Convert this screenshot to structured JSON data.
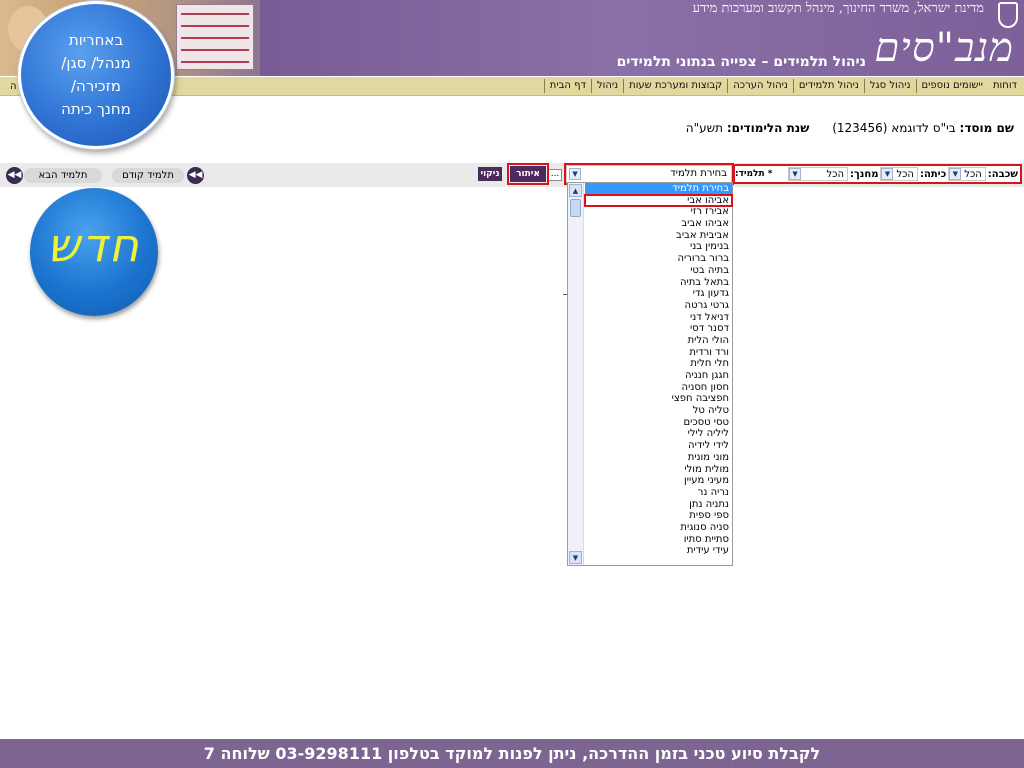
{
  "header": {
    "ministry_text": "מדינת ישראל, משרד החינוך, מינהל תקשוב ומערכות מידע",
    "logo_text": "מנב\"סים",
    "subtitle": "ניהול תלמידים – צפייה בנתוני תלמידים"
  },
  "nav": {
    "items": [
      "דף הבית",
      "ניהול",
      "קבוצות ומערכת שעות",
      "ניהול הערכה",
      "ניהול תלמידים",
      "ניהול סגל",
      "יישומים נוספים",
      "דוחות"
    ],
    "stub": "ה"
  },
  "institute": {
    "name_label": "שם מוסד:",
    "name_value": "בי\"ס לדוגמא (123456)",
    "year_label": "שנת הלימודים:",
    "year_value": "תשע\"ה"
  },
  "filters": {
    "grade_label": "שכבה:",
    "grade_value": "הכל",
    "class_label": "כיתה:",
    "class_value": "הכל",
    "teacher_label": "מחנך:",
    "teacher_value": "הכל",
    "student_label": "* תלמיד:",
    "student_value": "בחירת תלמיד",
    "dots": "...",
    "filter_button": "איתור",
    "clear_button": "ניקוי",
    "prev_student": "תלמיד קודם",
    "next_student": "תלמיד הבא"
  },
  "student_list": {
    "items": [
      "בחירת תלמיד",
      "אביהו אבי",
      "אבירז רזי",
      "אביהו אביב",
      "אביבית אביב",
      "בנימין בני",
      "ברור ברוריה",
      "בתיה בטי",
      "בתאל בתיה",
      "גדעון גדי",
      "גרטי גרטה",
      "דניאל דני",
      "דסנר דסי",
      "הולי הלית",
      "ורד ורדית",
      "חלי חלית",
      "חגגן חנניה",
      "חסון חסניה",
      "חפציבה חפצי",
      "טליה טל",
      "טסי טסכים",
      "ליליה לילי",
      "לידי לידיה",
      "מוני מונית",
      "מולית מולי",
      "מעיני מעיין",
      "נריה נר",
      "נתניה נתן",
      "ספי ספית",
      "סניה סנוגית",
      "סתיית סתיו",
      "עידי עידית"
    ],
    "selected_index": 0,
    "boxed_index": 1
  },
  "bubble": {
    "lines": [
      "באחריות",
      "מנהל/ סגן/",
      "מזכירה/",
      "מחנך כיתה"
    ]
  },
  "new_badge": {
    "text": "חדש"
  },
  "footer": {
    "text": "לקבלת סיוע טכני בזמן ההדרכה, ניתן לפנות למוקד בטלפון 03-9298111 שלוחה 7"
  },
  "colors": {
    "header_purple": "#7b5e98",
    "nav_bg": "#e3d7a0",
    "highlight_red": "#d7141c",
    "button_purple": "#4d2a5c",
    "selected_blue": "#3399ff",
    "footer_purple": "#7c6590",
    "badge_text": "#ecf23a"
  }
}
